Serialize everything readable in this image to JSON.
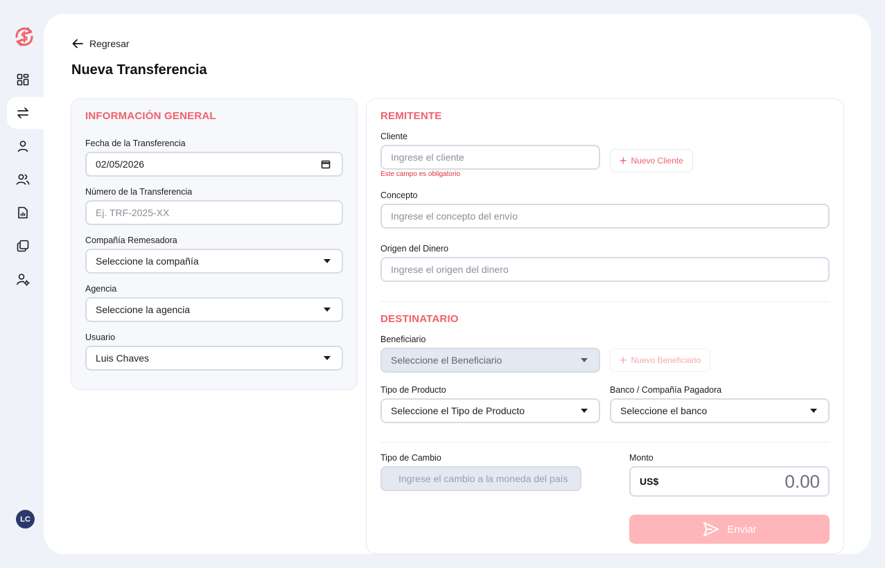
{
  "nav": {
    "back_label": "Regresar",
    "page_title": "Nueva Transferencia",
    "avatar_initials": "LC",
    "items": [
      "dashboard-icon",
      "transfer-icon",
      "user-icon",
      "users-icon",
      "report-icon",
      "copy-icon",
      "user-settings-icon"
    ]
  },
  "general": {
    "title": "INFORMACIÓN GENERAL",
    "fecha_label": "Fecha de la Transferencia",
    "fecha_value": "02/05/2026",
    "numero_label": "Número de la Transferencia",
    "numero_placeholder": "Ej. TRF-2025-XX",
    "compania_label": "Compañía Remesadora",
    "compania_value": "Seleccione la compañía",
    "agencia_label": "Agencia",
    "agencia_value": "Seleccione la agencia",
    "usuario_label": "Usuario",
    "usuario_value": "Luis Chaves"
  },
  "remitente": {
    "title": "REMITENTE",
    "cliente_label": "Cliente",
    "cliente_placeholder": "Ingrese el cliente",
    "cliente_error": "Este campo es obligatorio",
    "nuevo_cliente": "Nuevo Cliente",
    "concepto_label": "Concepto",
    "concepto_placeholder": "Ingrese el concepto del envío",
    "origen_label": "Origen del Dinero",
    "origen_placeholder": "Ingrese el origen del dinero"
  },
  "destinatario": {
    "title": "DESTINATARIO",
    "beneficiario_label": "Beneficiario",
    "beneficiario_value": "Seleccione el Beneficiario",
    "nuevo_beneficiario": "Nuevo Beneficiario",
    "producto_label": "Tipo de Producto",
    "producto_value": "Seleccione el Tipo de Producto",
    "banco_label": "Banco / Compañía Pagadora",
    "banco_value": "Seleccione el banco",
    "cambio_label": "Tipo de Cambio",
    "cambio_placeholder": "Ingrese el cambio a la moneda del país",
    "monto_label": "Monto",
    "monto_currency": "US$",
    "monto_value": "0.00",
    "enviar_label": "Enviar"
  },
  "colors": {
    "accent": "#f0616a",
    "send_disabled": "#ffb6b9",
    "avatar": "#2c3a6b"
  }
}
